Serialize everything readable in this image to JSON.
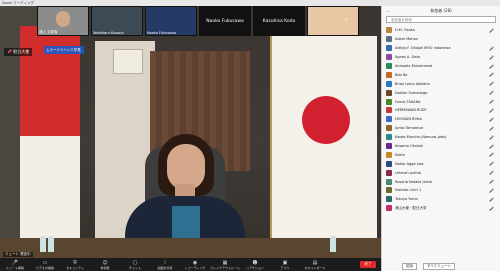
{
  "window": {
    "title": "Zoom ミーティング"
  },
  "thumbnails": [
    {
      "name": "浦上 文部省"
    },
    {
      "name": "Yoshiharu Kusano"
    },
    {
      "name": "Naoko Fukusawa"
    },
    {
      "name": "Naoko Fukusawa"
    },
    {
      "name": "Kazuhisa Koda"
    }
  ],
  "overlay": {
    "speaker_tag": "📌 駐日大使",
    "chat_popup": "ムラーナミハイエ学長",
    "mic_name": "ミュート 発言中"
  },
  "toolbar": [
    {
      "label": "ミュート解除",
      "icon": "mic-icon"
    },
    {
      "label": "ビデオの開始",
      "icon": "video-icon"
    },
    {
      "label": "セキュリティ",
      "icon": "shield-icon"
    },
    {
      "label": "参加者",
      "icon": "participants-icon"
    },
    {
      "label": "チャット",
      "icon": "chat-icon"
    },
    {
      "label": "画面を共有",
      "icon": "share-icon",
      "green": true
    },
    {
      "label": "レコーディング",
      "icon": "record-icon"
    },
    {
      "label": "ブレイクアウトルーム",
      "icon": "breakout-icon"
    },
    {
      "label": "リアクション",
      "icon": "reaction-icon"
    },
    {
      "label": "アプリ",
      "icon": "apps-icon"
    },
    {
      "label": "ホワイトボード",
      "icon": "whiteboard-icon"
    }
  ],
  "leave_label": "終了",
  "panel": {
    "title": "参加者 (28)",
    "search_placeholder": "参加者を検索",
    "participants": [
      {
        "name": "H.M. Osaka",
        "color": "#b8863b",
        "icon": "🎤"
      },
      {
        "name": "Adam Mahan",
        "color": "#5b6f8a",
        "icon": ""
      },
      {
        "name": "Aditya F. Ghajali MOU Indonesia",
        "color": "#3b6ab8",
        "icon": "🎤"
      },
      {
        "name": "Agnes A. Dwie",
        "color": "#8a4c9e",
        "icon": "🎤"
      },
      {
        "name": "Ahmadia Muhammad",
        "color": "#2f8a57",
        "icon": "🎤"
      },
      {
        "name": "Bob Bo",
        "color": "#c66a2a",
        "icon": "🎤"
      },
      {
        "name": "Brian Ivans Alakaha",
        "color": "#2a7ac6",
        "icon": "🎤"
      },
      {
        "name": "Dahlan Sumedngo",
        "color": "#6a4a2a",
        "icon": "🎤"
      },
      {
        "name": "Fumio TAKANA",
        "color": "#4a8a2a",
        "icon": "🎤"
      },
      {
        "name": "HERMAWAN RUDY",
        "color": "#c63a3a",
        "icon": "🎤"
      },
      {
        "name": "HOSSAIN Rifika",
        "color": "#3a6ac6",
        "icon": "🎤"
      },
      {
        "name": "Junko Tomomise",
        "color": "#8a6a2a",
        "icon": "🎤"
      },
      {
        "name": "Kaoko Maruha (Nomura-Jobs)",
        "color": "#2a8a8a",
        "icon": "🎤"
      },
      {
        "name": "Kusama Ohnishi",
        "color": "#6a2a8a",
        "icon": "🎤"
      },
      {
        "name": "Kulite",
        "color": "#c6862a",
        "icon": "🎤"
      },
      {
        "name": "Nahar Agge sisa",
        "color": "#2a4a8a",
        "icon": "🎤"
      },
      {
        "name": "rahmah puthia",
        "color": "#8a2a4a",
        "icon": "🎤"
      },
      {
        "name": "Rosaria Natalia Jelvia",
        "color": "#4a8a6a",
        "icon": "🎤"
      },
      {
        "name": "Saktoto Likiri 1",
        "color": "#6a6a2a",
        "icon": "🎤"
      },
      {
        "name": "Takuya Yuma",
        "color": "#2a6a6a",
        "icon": "🎤"
      },
      {
        "name": "浦山大使・駐日大学",
        "color": "#c62a6a",
        "icon": "🎤"
      }
    ],
    "foot_invite": "招待",
    "foot_mute_all": "すべてミュート"
  },
  "colors": {
    "leave": "#e02828",
    "accent_green": "#27c24c"
  }
}
